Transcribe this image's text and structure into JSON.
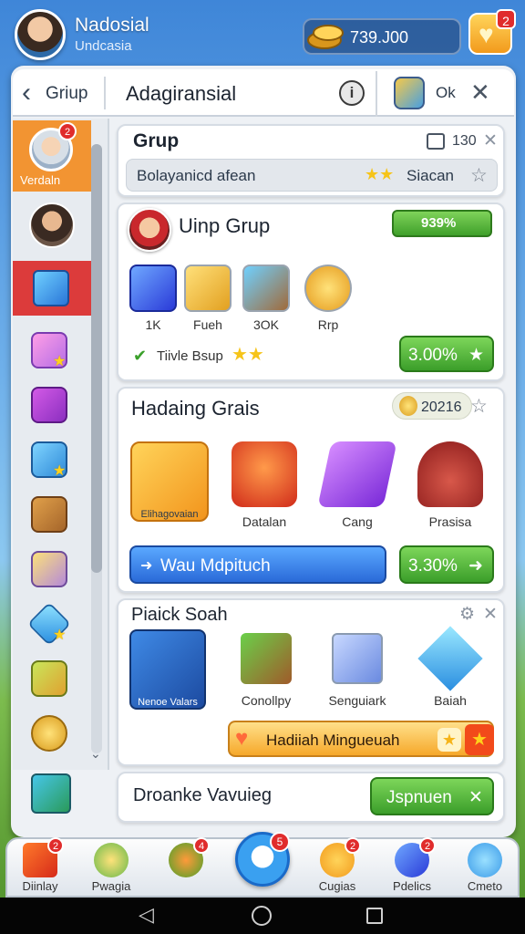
{
  "user": {
    "name": "Nadosial",
    "subtitle": "Undcasia"
  },
  "currency": {
    "value": "739.J00",
    "heart_badge": "2"
  },
  "header": {
    "back_label": "Griup",
    "title": "Adagiransial",
    "info_icon": "i",
    "ok_label": "Ok"
  },
  "sidebar": {
    "items": [
      {
        "label": "Verdaln",
        "icon": "avatar-icon",
        "badge": "2"
      },
      {
        "icon": "avatar-icon"
      },
      {
        "icon": "blue-shape-icon"
      },
      {
        "icon": "pink-badge-icon"
      },
      {
        "icon": "purple-star-icon"
      },
      {
        "icon": "blue-card-icon"
      },
      {
        "icon": "wooden-box-icon"
      },
      {
        "icon": "notice-board-icon"
      },
      {
        "icon": "blue-star-icon"
      },
      {
        "icon": "green-book-icon"
      },
      {
        "icon": "gold-coins-icon"
      }
    ]
  },
  "grup": {
    "title": "Grup",
    "count": "130",
    "search_value": "Bolayanicd afean",
    "search_tag": "Siacan"
  },
  "uinp": {
    "title": "Uinp Grup",
    "badge_value": "939%",
    "resources": [
      {
        "label": "1K"
      },
      {
        "label": "Fueh"
      },
      {
        "label": "3OK"
      },
      {
        "label": "Rrp"
      }
    ],
    "status": "Tiivle Bsup",
    "button": "3.00%"
  },
  "hadaing": {
    "title": "Hadaing Grais",
    "value": "20216",
    "items": [
      {
        "label": "Elihagovaian"
      },
      {
        "label": "Datalan"
      },
      {
        "label": "Cang"
      },
      {
        "label": "Prasisa"
      }
    ],
    "wide_button": "Wau Mdpituch",
    "button": "3.30%"
  },
  "piaick": {
    "title": "Piaick Soah",
    "items": [
      {
        "label": "Nenoe Valars"
      },
      {
        "label": "Conollpy"
      },
      {
        "label": "Senguiark"
      },
      {
        "label": "Baiah"
      }
    ],
    "button": "Hadiiah Mingueuah"
  },
  "droanke": {
    "title": "Droanke Vavuieg",
    "button": "Jspnuen"
  },
  "bottom_nav": {
    "items": [
      {
        "label": "Diinlay",
        "badge": "2"
      },
      {
        "label": "Pwagia"
      },
      {
        "label": "",
        "badge": "4"
      },
      {
        "label": "Cugias",
        "badge": "2"
      },
      {
        "label": "Pdelics",
        "badge": "2"
      },
      {
        "label": "Cmeto"
      }
    ],
    "center_badge": "5"
  },
  "colors": {
    "accent_orange": "#f29432",
    "accent_red": "#dc3b3b",
    "accent_green": "#3b9e2a",
    "accent_blue": "#2a6ad8"
  }
}
